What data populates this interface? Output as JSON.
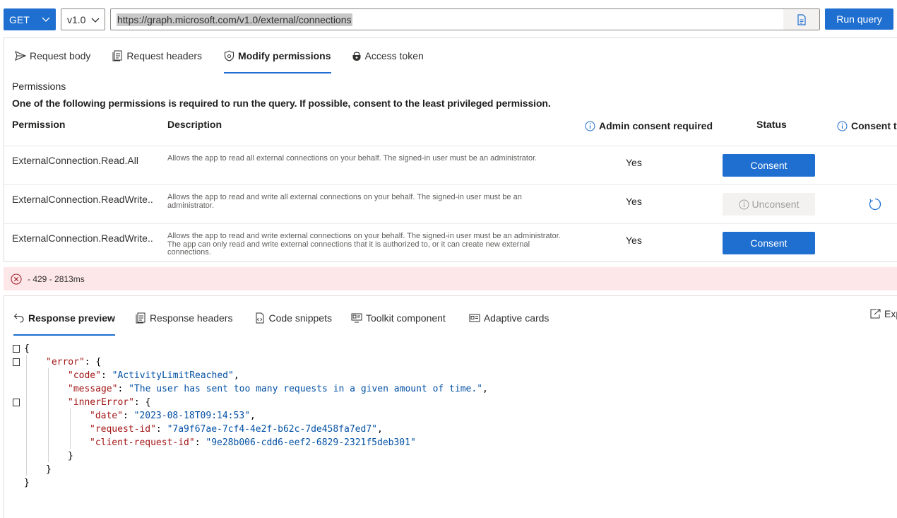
{
  "toolbar": {
    "method": "GET",
    "version": "v1.0",
    "url": "https://graph.microsoft.com/v1.0/external/connections",
    "run_label": "Run query"
  },
  "request_tabs": [
    {
      "label": "Request body",
      "icon": "send-icon"
    },
    {
      "label": "Request headers",
      "icon": "document-icon"
    },
    {
      "label": "Modify permissions",
      "icon": "shield-icon",
      "active": true
    },
    {
      "label": "Access token",
      "icon": "lock-icon"
    }
  ],
  "permissions": {
    "title": "Permissions",
    "description": "One of the following permissions is required to run the query. If possible, consent to the least privileged permission.",
    "columns": {
      "permission": "Permission",
      "description": "Description",
      "admin": "Admin consent required",
      "status": "Status",
      "consent_type": "Consent ty"
    },
    "rows": [
      {
        "name": "ExternalConnection.Read.All",
        "description": "Allows the app to read all external connections on your behalf. The signed-in user must be an administrator.",
        "admin": "Yes",
        "action": "Consent",
        "disabled": false
      },
      {
        "name": "ExternalConnection.ReadWrite....",
        "description": "Allows the app to read and write all external connections on your behalf. The signed-in user must be an administrator.",
        "admin": "Yes",
        "action": "Unconsent",
        "disabled": true
      },
      {
        "name": "ExternalConnection.ReadWrite....",
        "description": "Allows the app to read and write external connections on your behalf. The signed-in user must be an administrator. The app can only read and write external connections that it is authorized to, or it can create new external connections.",
        "admin": "Yes",
        "action": "Consent",
        "disabled": false
      }
    ]
  },
  "status": {
    "text": "- 429 - 2813ms",
    "color": "#fde7e9"
  },
  "response_tabs": [
    {
      "label": "Response preview",
      "icon": "undo-icon",
      "active": true
    },
    {
      "label": "Response headers",
      "icon": "document-icon"
    },
    {
      "label": "Code snippets",
      "icon": "code-icon"
    },
    {
      "label": "Toolkit component",
      "icon": "toolkit-icon"
    },
    {
      "label": "Adaptive cards",
      "icon": "card-icon"
    }
  ],
  "export_label": "Exp",
  "response_json": {
    "error_key": "\"error\"",
    "code_key": "\"code\"",
    "code_val": "\"ActivityLimitReached\"",
    "message_key": "\"message\"",
    "message_val": "\"The user has sent too many requests in a given amount of time.\"",
    "inner_key": "\"innerError\"",
    "date_key": "\"date\"",
    "date_val": "\"2023-08-18T09:14:53\"",
    "reqid_key": "\"request-id\"",
    "reqid_val": "\"7a9f67ae-7cf4-4e2f-b62c-7de458fa7ed7\"",
    "cliid_key": "\"client-request-id\"",
    "cliid_val": "\"9e28b006-cdd6-eef2-6829-2321f5deb301\""
  },
  "colors": {
    "accent": "#1f6fd0",
    "error_bg": "#fde7e9",
    "json_key": "#a31515",
    "json_string": "#0451a5"
  }
}
